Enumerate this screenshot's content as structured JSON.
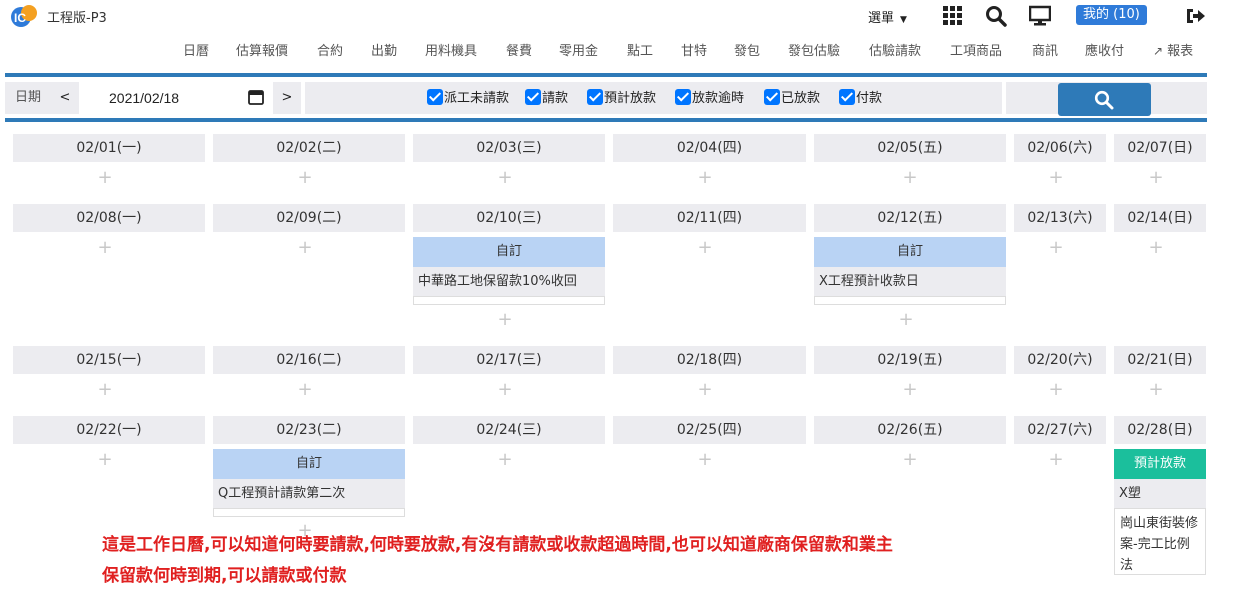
{
  "header": {
    "app_title": "工程版-P3",
    "menu_label": "選單",
    "mine_badge": "我的 (10)"
  },
  "icons": {
    "logo": "logo-icon",
    "grid": "grid-icon",
    "search": "search-icon",
    "monitor": "monitor-icon",
    "logout": "logout-icon",
    "calendar": "calendar-icon",
    "add": "add-icon",
    "chart": "trend-icon"
  },
  "nav": {
    "items": [
      "日曆",
      "估算報價",
      "合約",
      "出勤",
      "用料機具",
      "餐費",
      "零用金",
      "點工",
      "甘特",
      "發包",
      "發包估驗",
      "估驗請款",
      "工項商品",
      "商訊",
      "應收付",
      "報表"
    ]
  },
  "toolbar": {
    "date_label": "日期",
    "prev": "<",
    "next": ">",
    "date_value": "2021/02/18",
    "filters": [
      "派工未請款",
      "請款",
      "預計放款",
      "放款逾時",
      "已放款",
      "付款"
    ]
  },
  "calendar": {
    "weeks": [
      [
        "02/01(一)",
        "02/02(二)",
        "02/03(三)",
        "02/04(四)",
        "02/05(五)",
        "02/06(六)",
        "02/07(日)"
      ],
      [
        "02/08(一)",
        "02/09(二)",
        "02/10(三)",
        "02/11(四)",
        "02/12(五)",
        "02/13(六)",
        "02/14(日)"
      ],
      [
        "02/15(一)",
        "02/16(二)",
        "02/17(三)",
        "02/18(四)",
        "02/19(五)",
        "02/20(六)",
        "02/21(日)"
      ],
      [
        "02/22(一)",
        "02/23(二)",
        "02/24(三)",
        "02/25(四)",
        "02/26(五)",
        "02/27(六)",
        "02/28(日)"
      ]
    ],
    "events": [
      {
        "type": "自訂",
        "title": "中華路工地保留款10%收回"
      },
      {
        "type": "自訂",
        "title": "X工程預計收款日"
      },
      {
        "type": "自訂",
        "title": "Q工程預計請款第二次"
      },
      {
        "type": "預計放款",
        "title": "X塑",
        "detail": "崗山東街裝修案-完工比例法"
      }
    ]
  },
  "annotation": {
    "line1": "這是工作日曆,可以知道何時要請款,何時要放款,有沒有請款或收款超過時間,也可以知道廠商保留款和業主",
    "line2": "保留款何時到期,可以請款或付款"
  },
  "colors": {
    "accent": "#2e7ab8",
    "event_blue": "#b9d3f4",
    "event_teal": "#1bbf9c",
    "note_red": "#e02020"
  }
}
